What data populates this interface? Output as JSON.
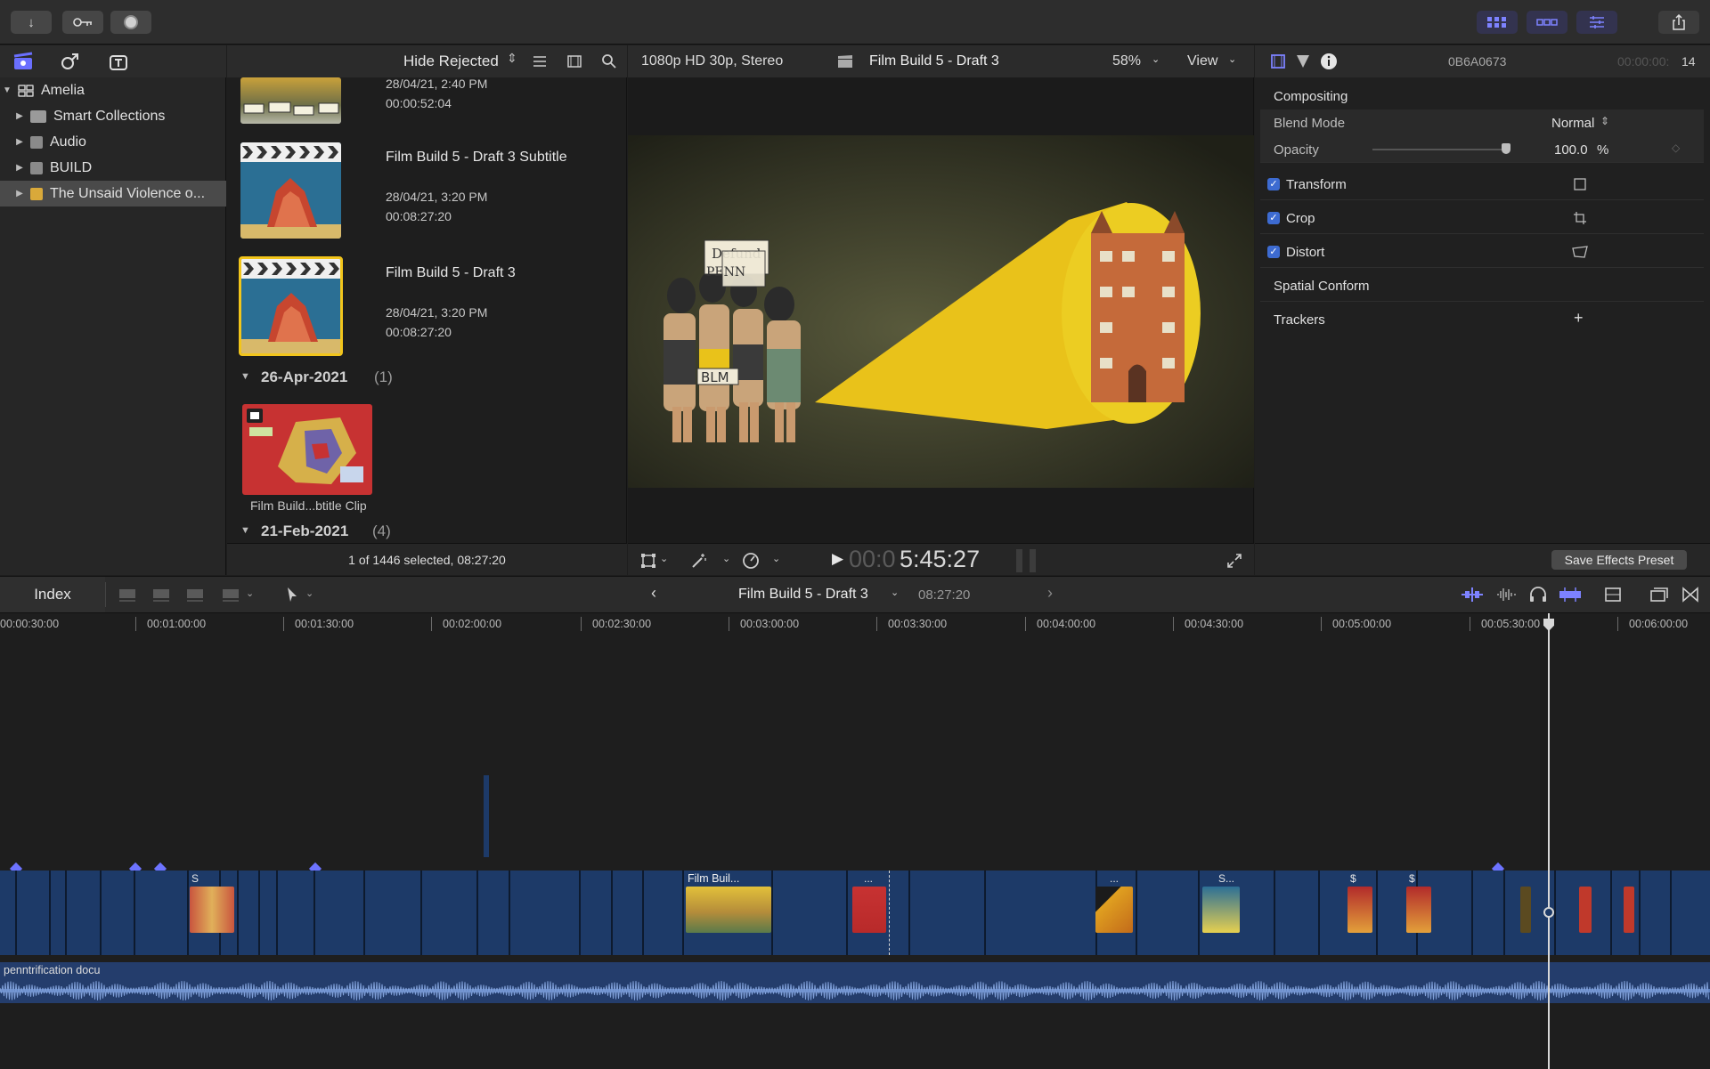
{
  "viewer": {
    "format": "1080p HD 30p, Stereo",
    "project_title": "Film Build 5 - Draft 3",
    "zoom": "58%",
    "view_label": "View",
    "timecode_dim": "00:0",
    "timecode": "5:45:27"
  },
  "library": {
    "items": [
      {
        "label": "Amelia",
        "expanded": true
      },
      {
        "label": "Smart Collections"
      },
      {
        "label": "Audio"
      },
      {
        "label": "BUILD"
      },
      {
        "label": "The Unsaid Violence o...",
        "selected": true
      }
    ]
  },
  "browser": {
    "filter_label": "Hide Rejected",
    "clips": [
      {
        "meta1": "28/04/21, 2:40 PM",
        "meta2": "00:00:52:04"
      },
      {
        "title": "Film Build 5 - Draft 3 Subtitle",
        "meta1": "28/04/21, 3:20 PM",
        "meta2": "00:08:27:20"
      },
      {
        "title": "Film Build 5 - Draft 3",
        "meta1": "28/04/21, 3:20 PM",
        "meta2": "00:08:27:20",
        "selected": true
      }
    ],
    "groups": [
      {
        "label": "26-Apr-2021",
        "count": "(1)"
      },
      {
        "label": "21-Feb-2021",
        "count": "(4)"
      }
    ],
    "clip4_caption": "Film Build...btitle Clip",
    "status": "1 of 1446 selected, 08:27:20"
  },
  "inspector": {
    "clip_name": "0B6A0673",
    "timecode_dim": "00:00:00:",
    "timecode": "14",
    "section": "Compositing",
    "blend_label": "Blend Mode",
    "blend_value": "Normal",
    "opacity_label": "Opacity",
    "opacity_value": "100.0",
    "opacity_unit": "%",
    "opacity_level": 1.0,
    "rows": [
      {
        "label": "Transform",
        "checked": true
      },
      {
        "label": "Crop",
        "checked": true
      },
      {
        "label": "Distort",
        "checked": true
      },
      {
        "label": "Spatial Conform",
        "checked": false
      },
      {
        "label": "Trackers",
        "checked": false
      }
    ],
    "save_preset": "Save Effects Preset"
  },
  "timeline": {
    "index_label": "Index",
    "project_title": "Film Build 5 - Draft 3",
    "duration": "08:27:20",
    "ruler": [
      "00:00:30:00",
      "00:01:00:00",
      "00:01:30:00",
      "00:02:00:00",
      "00:02:30:00",
      "00:03:00:00",
      "00:03:30:00",
      "00:04:00:00",
      "00:04:30:00",
      "00:05:00:00",
      "00:05:30:00",
      "00:06:00:00"
    ],
    "clip_labels": [
      "S",
      "Film Buil...",
      "...",
      "...",
      "S...",
      "$",
      "$"
    ],
    "audio_label": "penntrification docu"
  },
  "colors": {
    "accent": "#6d73ff",
    "selection_yellow": "#f2c51b",
    "clip_blue": "#1d3a68",
    "playhead": "#d8d8d8"
  }
}
